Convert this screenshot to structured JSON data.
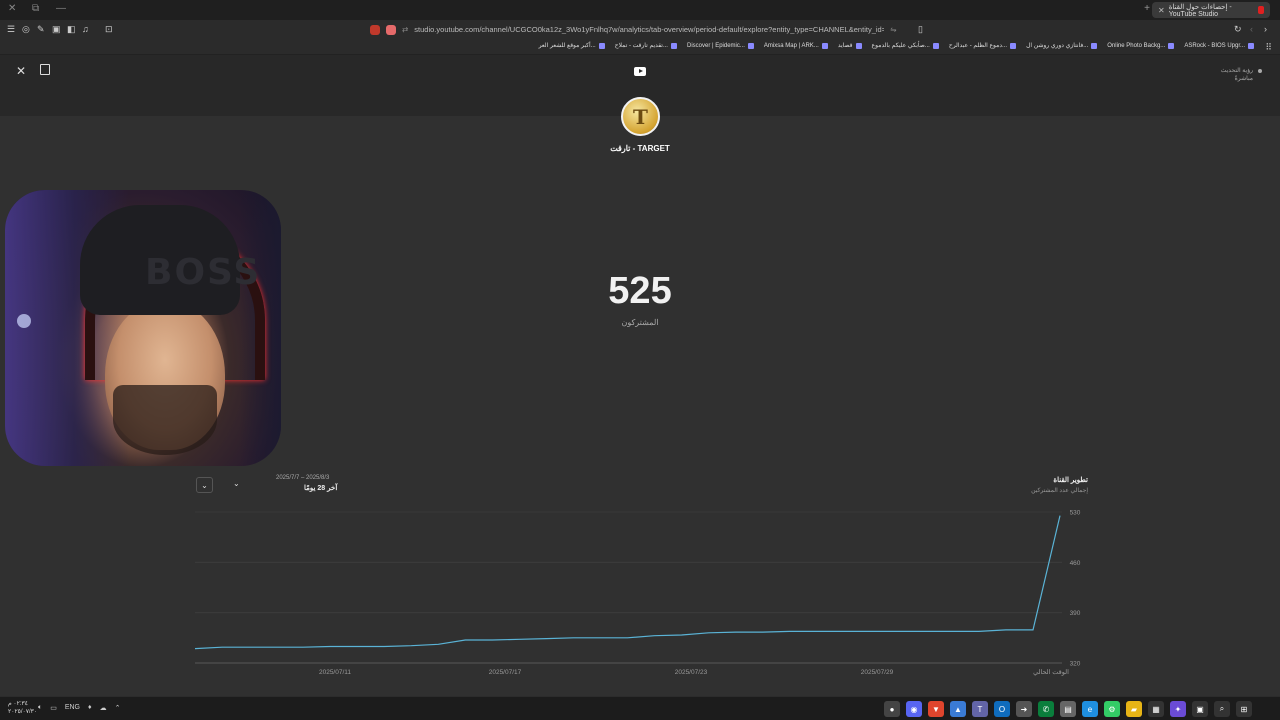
{
  "browser": {
    "tab_title": "إحصاءات حول القناة - YouTube Studio",
    "url": "studio.youtube.com/channel/UCGCO0ka12z_3Wo1yFnlhq7w/analytics/tab-overview/period-default/explore?entity_type=CHANNEL&entity_id=UCGC...",
    "bookmarks": [
      {
        "label": "ASRock - BIOS Upgr..."
      },
      {
        "label": "Online Photo Backg..."
      },
      {
        "label": "فانتازي دوري روشن ال..."
      },
      {
        "label": "دموع الظلم - عبدالرح..."
      },
      {
        "label": "صأبكي عليكم بالدموع..."
      },
      {
        "label": "قصايد"
      },
      {
        "label": "Amixsa Map | ARK..."
      },
      {
        "label": "Discover | Epidemic..."
      },
      {
        "label": "تقديم تارقت - تملاح..."
      },
      {
        "label": "أكبر موقع للشعر العر..."
      }
    ]
  },
  "panel": {
    "live_label": "رؤية التحديث",
    "live_sub": "مباشرةً",
    "channel_name": "تارقت - TARGET",
    "avatar_letter": "T",
    "webcam_cap_text": "BOSS"
  },
  "stat": {
    "value": "525",
    "label": "المشتركون"
  },
  "chart_panel": {
    "title": "تطوير القناة",
    "subtitle": "إجمالي عدد المشتركين",
    "period_range": "2025/7/7 – 2025/8/3",
    "period_label": "آخر 28 يومًا",
    "dropdown_icon": "chevron-down-icon"
  },
  "chart_data": {
    "type": "line",
    "title": "تطوير القناة",
    "ylabel": "",
    "xlabel": "",
    "ylim": [
      320,
      530
    ],
    "y_ticks": [
      "530",
      "460",
      "390",
      "320"
    ],
    "x_ticks": [
      "2025/07/11",
      "2025/07/17",
      "2025/07/23",
      "2025/07/29",
      "الوقت الحالي"
    ],
    "grid": true,
    "series": [
      {
        "color": "#5ab3d6",
        "values": [
          340,
          342,
          342,
          342,
          342,
          343,
          343,
          343,
          344,
          346,
          352,
          352,
          353,
          354,
          355,
          355,
          355,
          358,
          359,
          362,
          363,
          363,
          364,
          364,
          364,
          364,
          364,
          364,
          364,
          364,
          366,
          366,
          525
        ]
      }
    ]
  },
  "taskbar": {
    "time": "٠٢:٣٤ م",
    "date": "٢٠٢٥/٠٧/٣٠",
    "lang": "ENG"
  }
}
